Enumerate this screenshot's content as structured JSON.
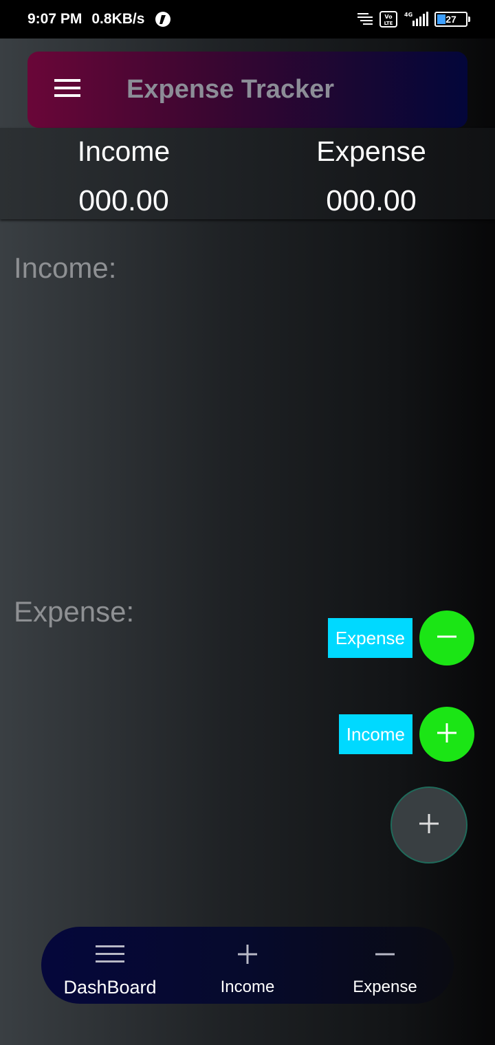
{
  "status_bar": {
    "time": "9:07 PM",
    "network_speed": "0.8KB/s",
    "battery_level": "27",
    "icons": [
      "app-notification-icon",
      "notification-list-icon",
      "volte-icon",
      "signal-4g-icon",
      "battery-icon"
    ]
  },
  "app_bar": {
    "title": "Expense Tracker",
    "menu_icon": "hamburger-menu-icon"
  },
  "summary": {
    "income_label": "Income",
    "income_value": "000.00",
    "expense_label": "Expense",
    "expense_value": "000.00"
  },
  "sections": {
    "income_heading": "Income:",
    "expense_heading": "Expense:"
  },
  "fab_menu": {
    "expense_label": "Expense",
    "income_label": "Income",
    "expense_icon": "minus-icon",
    "income_icon": "plus-icon",
    "main_icon": "plus-icon"
  },
  "bottom_nav": {
    "items": [
      {
        "label": "DashBoard",
        "icon": "hamburger-menu-icon"
      },
      {
        "label": "Income",
        "icon": "plus-icon"
      },
      {
        "label": "Expense",
        "icon": "minus-icon"
      }
    ]
  },
  "colors": {
    "fab_chip": "#00d9ff",
    "fab_mini": "#1be515",
    "app_bar_start": "#6a0638",
    "app_bar_end": "#03063a",
    "nav_bg": "#05073b"
  }
}
